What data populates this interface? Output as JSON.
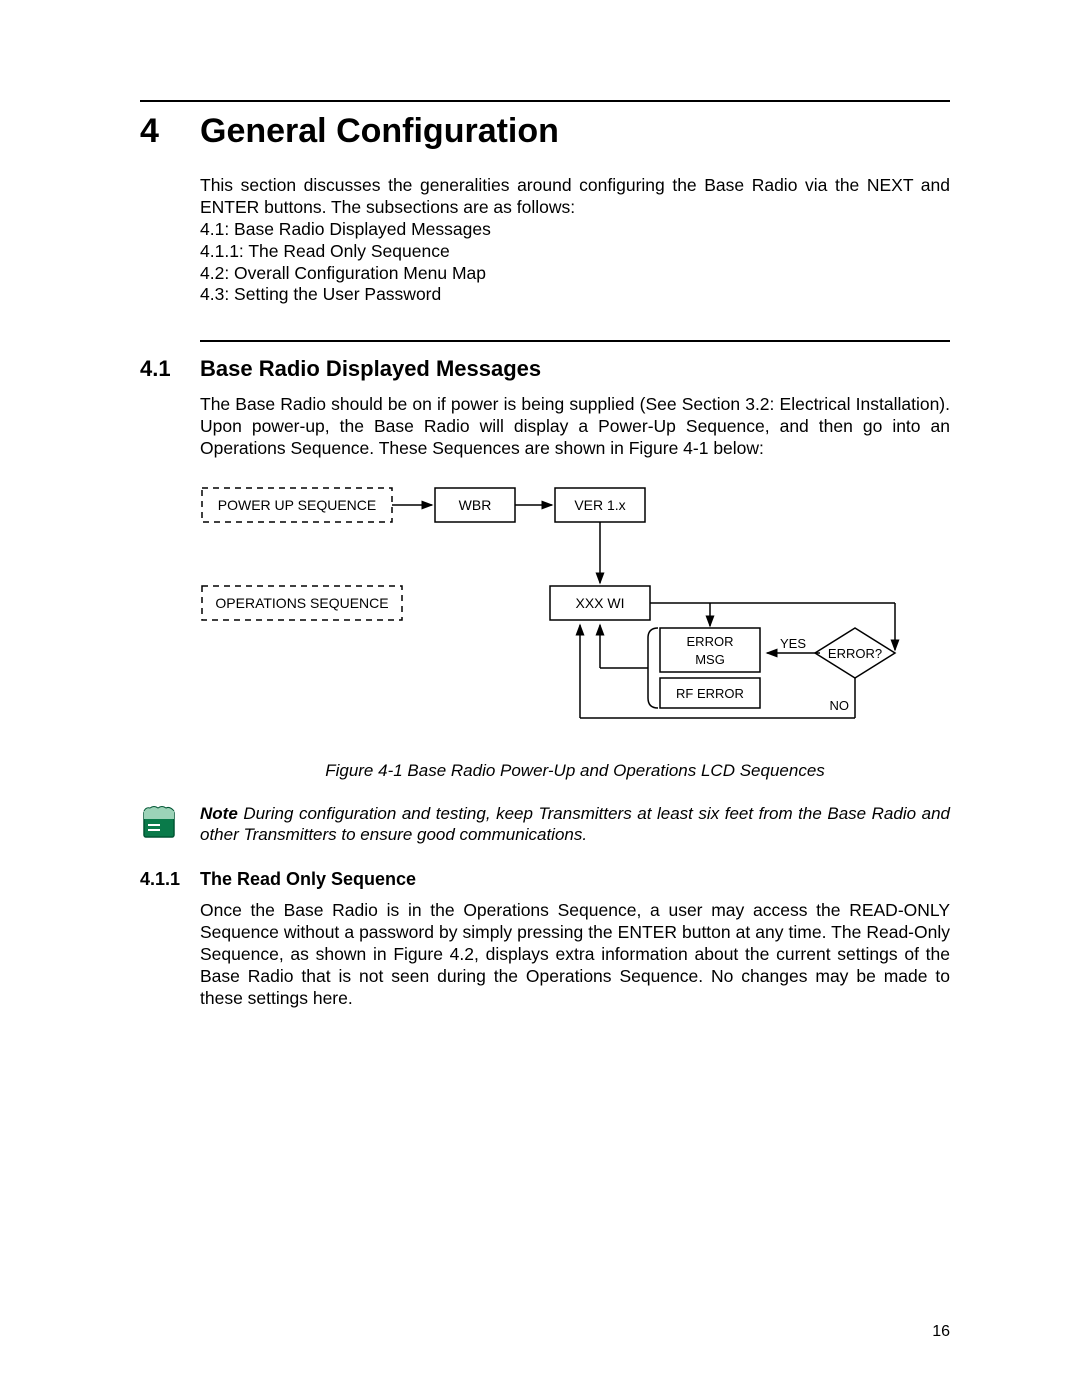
{
  "chapter": {
    "number": "4",
    "title": "General Configuration"
  },
  "intro": {
    "lead": "This section discusses the generalities around configuring the Base Radio via the NEXT and ENTER buttons. The subsections are as follows:",
    "items": [
      "4.1: Base Radio Displayed Messages",
      "4.1.1: The Read Only Sequence",
      "4.2: Overall Configuration Menu Map",
      "4.3: Setting the User Password"
    ]
  },
  "section41": {
    "number": "4.1",
    "title": "Base Radio Displayed Messages",
    "body": "The Base Radio should be on if power is being supplied (See Section 3.2: Electrical Installation). Upon power-up, the Base Radio will display a Power-Up Sequence, and then go into an Operations Sequence. These Sequences are shown in Figure 4-1 below:"
  },
  "flowchart": {
    "power_up_label": "POWER UP SEQUENCE",
    "operations_label": "OPERATIONS SEQUENCE",
    "wbr": "WBR",
    "ver": "VER 1.x",
    "xxx": "XXX WI",
    "error_msg": "ERROR MSG",
    "rf_error": "RF ERROR",
    "error_q": "ERROR?",
    "yes": "YES",
    "no": "NO"
  },
  "figure_caption": "Figure 4-1 Base Radio Power-Up and Operations LCD Sequences",
  "note": {
    "label": "Note",
    "text": "During configuration and testing, keep Transmitters at least six feet from the Base Radio and other Transmitters to ensure good communications."
  },
  "section411": {
    "number": "4.1.1",
    "title": "The Read Only Sequence",
    "body": "Once the Base Radio is in the Operations Sequence, a user may access the READ-ONLY Sequence without a password by simply pressing the ENTER button at any time. The Read-Only Sequence, as shown in Figure 4.2, displays extra information about the current settings of the Base Radio that is not seen during the Operations Sequence. No changes may be made to these settings here."
  },
  "page_number": "16"
}
